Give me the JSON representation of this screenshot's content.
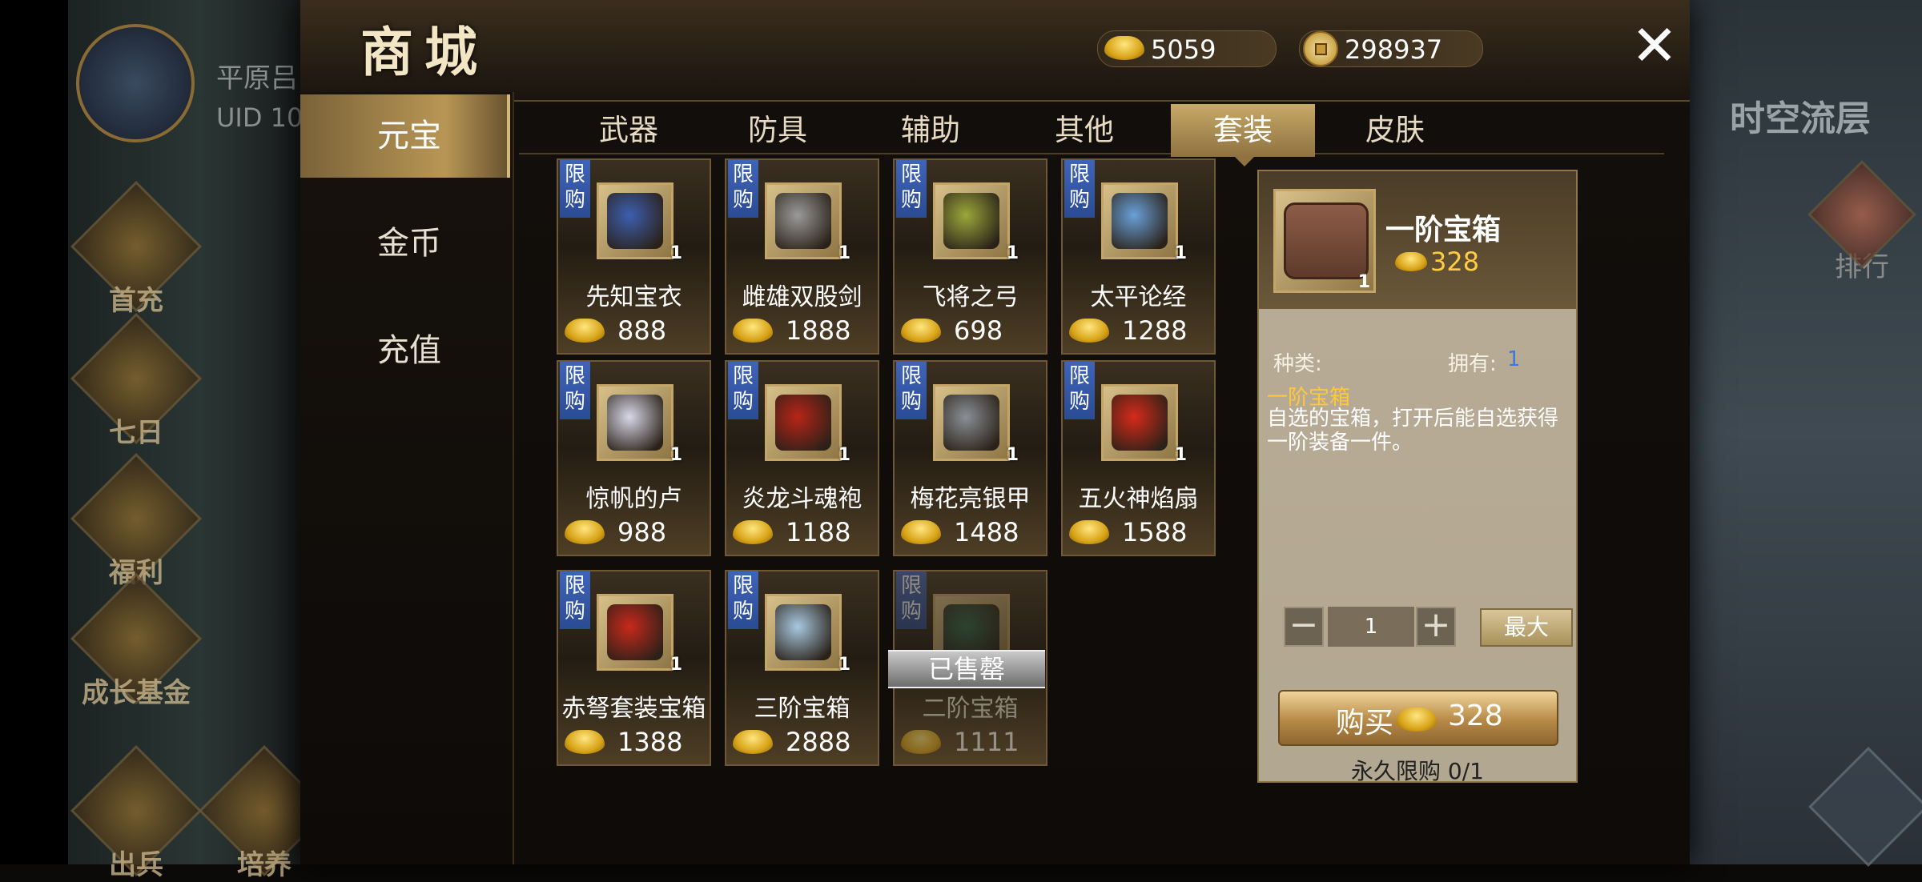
{
  "header": {
    "title": "商城",
    "currencies": [
      {
        "icon": "gold-ingot-icon",
        "value": "5059"
      },
      {
        "icon": "coin-icon",
        "value": "298937"
      }
    ],
    "close_icon": "close-icon"
  },
  "background": {
    "player_name": "平原吕",
    "player_uid": "UID 10",
    "left_menu": [
      "首充",
      "七日",
      "福利",
      "成长基金",
      "出兵",
      "培养"
    ],
    "right_title": "时空流层",
    "right_menu": [
      "排行"
    ]
  },
  "left_nav": [
    {
      "label": "元宝",
      "active": true
    },
    {
      "label": "金币",
      "active": false
    },
    {
      "label": "充值",
      "active": false
    }
  ],
  "tabs": [
    {
      "label": "武器",
      "active": false
    },
    {
      "label": "防具",
      "active": false
    },
    {
      "label": "辅助",
      "active": false
    },
    {
      "label": "其他",
      "active": false
    },
    {
      "label": "套装",
      "active": true
    },
    {
      "label": "皮肤",
      "active": false
    }
  ],
  "items": [
    {
      "name": "先知宝衣",
      "price": "888",
      "qty": "1",
      "tag": "限购",
      "sold": false,
      "color": "#3d5fb0"
    },
    {
      "name": "雌雄双股剑",
      "price": "1888",
      "qty": "1",
      "tag": "限购",
      "sold": false,
      "color": "#9a9a9a"
    },
    {
      "name": "飞将之弓",
      "price": "698",
      "qty": "1",
      "tag": "限购",
      "sold": false,
      "color": "#9aa83a"
    },
    {
      "name": "太平论经",
      "price": "1288",
      "qty": "1",
      "tag": "限购",
      "sold": false,
      "color": "#6aa0d8"
    },
    {
      "name": "惊帆的卢",
      "price": "988",
      "qty": "1",
      "tag": "限购",
      "sold": false,
      "color": "#d8d8e8"
    },
    {
      "name": "炎龙斗魂袍",
      "price": "1188",
      "qty": "1",
      "tag": "限购",
      "sold": false,
      "color": "#b82418"
    },
    {
      "name": "梅花亮银甲",
      "price": "1488",
      "qty": "1",
      "tag": "限购",
      "sold": false,
      "color": "#8a8f96"
    },
    {
      "name": "五火神焰扇",
      "price": "1588",
      "qty": "1",
      "tag": "限购",
      "sold": false,
      "color": "#d62a1a"
    },
    {
      "name": "赤弩套装宝箱",
      "price": "1388",
      "qty": "1",
      "tag": "限购",
      "sold": false,
      "color": "#c8281c"
    },
    {
      "name": "三阶宝箱",
      "price": "2888",
      "qty": "1",
      "tag": "限购",
      "sold": false,
      "color": "#a8c8e0"
    },
    {
      "name": "二阶宝箱",
      "price": "1111",
      "qty": "",
      "tag": "限购",
      "sold": true,
      "sold_label": "已售罄",
      "color": "#2e6b4e"
    }
  ],
  "detail": {
    "name": "一阶宝箱",
    "price": "328",
    "qty": "1",
    "type_label": "种类:",
    "own_label": "拥有:",
    "own_value": "1",
    "desc_title": "一阶宝箱",
    "desc": "自选的宝箱，打开后能自选获得一阶装备一件。",
    "quantity": "1",
    "minus": "−",
    "plus": "+",
    "max_label": "最大",
    "buy_label": "购买",
    "buy_price": "328",
    "limit_text": "永久限购 0/1"
  }
}
